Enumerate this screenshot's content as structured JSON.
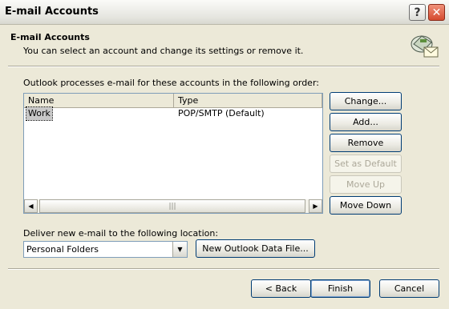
{
  "window": {
    "title": "E-mail Accounts",
    "help_button": "?",
    "close_button": "✕"
  },
  "header": {
    "title": "E-mail Accounts",
    "description": "You can select an account and change its settings or remove it.",
    "icon": "mail-accounts-icon"
  },
  "accounts": {
    "label": "Outlook processes e-mail for these accounts in the following order:",
    "columns": [
      "Name",
      "Type"
    ],
    "rows": [
      {
        "name": "Work",
        "type": "POP/SMTP (Default)"
      }
    ],
    "scroll_left": "◀",
    "scroll_right": "▶",
    "scroll_grip": "|||"
  },
  "side_buttons": {
    "change": "Change...",
    "add": "Add...",
    "remove": "Remove",
    "set_default": "Set as Default",
    "move_up": "Move Up",
    "move_down": "Move Down"
  },
  "delivery": {
    "label": "Deliver new e-mail to the following location:",
    "selected": "Personal Folders",
    "dropdown_arrow": "▼",
    "new_data_file": "New Outlook Data File..."
  },
  "footer": {
    "back": "< Back",
    "finish": "Finish",
    "cancel": "Cancel"
  }
}
